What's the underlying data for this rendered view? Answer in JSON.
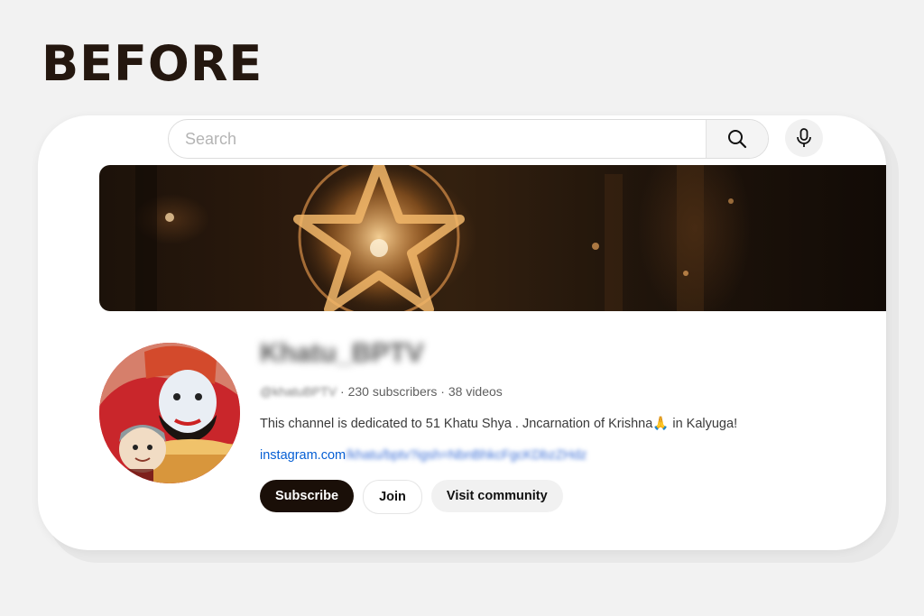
{
  "heading": "BEFORE",
  "search": {
    "placeholder": "Search",
    "search_icon": "search-icon",
    "mic_icon": "microphone-icon"
  },
  "banner": {
    "description_icon": "glowing-star-icon"
  },
  "channel": {
    "name": "Khatu_BPTV",
    "handle": "@khatuBPTV",
    "stats": "· 230 subscribers · 38 videos",
    "description": "This channel is dedicated to 51 Khatu Shya . Jncarnation of Krishna🙏 in Kalyuga!",
    "link_visible": "instagram.com",
    "link_blurred": "/khatu/bptv?igsh=NbnBhkcFgcKDbzZHdz"
  },
  "buttons": {
    "subscribe": "Subscribe",
    "join": "Join",
    "community": "Visit community"
  },
  "colors": {
    "heading": "#24170f",
    "subscribe_bg": "#1a0f08",
    "link": "#065fd4"
  }
}
